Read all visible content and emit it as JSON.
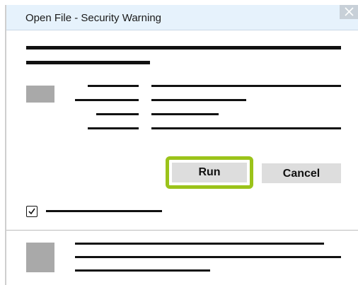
{
  "window": {
    "title": "Open File - Security Warning",
    "close_icon": "close-icon"
  },
  "buttons": {
    "run_label": "Run",
    "cancel_label": "Cancel"
  },
  "checkbox": {
    "checked": true,
    "icon": "checkmark-icon"
  },
  "icons": {
    "file": "file-icon",
    "shield": "shield-icon"
  },
  "colors": {
    "titlebar_bg": "#e6f2fc",
    "highlight_border": "#9bc31a",
    "button_bg": "#dddddd",
    "placeholder_gray": "#a9a9a9"
  }
}
